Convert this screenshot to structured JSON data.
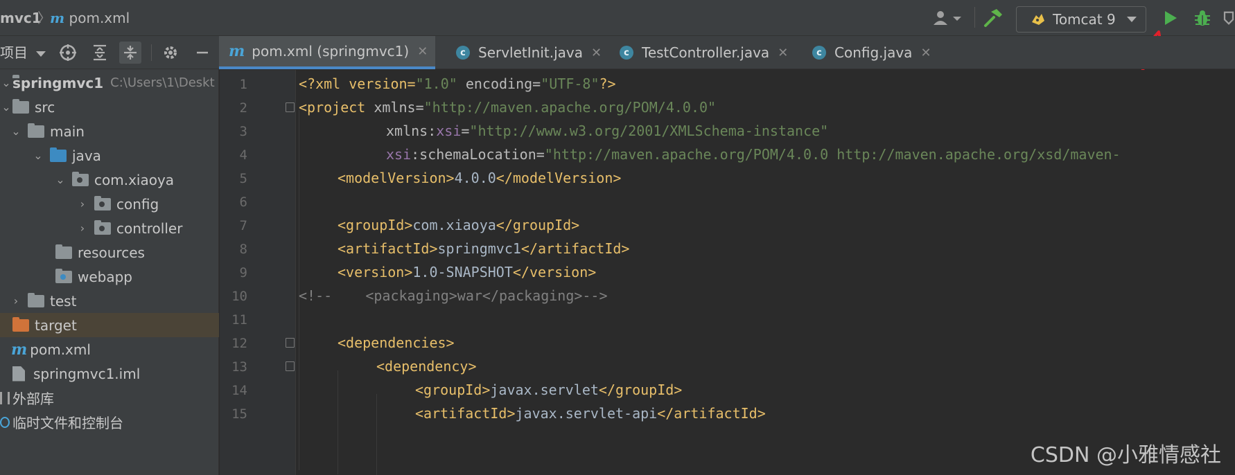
{
  "titlebar": {
    "project_crumb": "mvc1",
    "file_crumb": "pom.xml",
    "run_config": "Tomcat 9"
  },
  "project_toolbar": {
    "view_label": "项目"
  },
  "tabs": [
    {
      "label": "pom.xml (springmvc1)",
      "icon": "maven-icon",
      "active": true
    },
    {
      "label": "ServletInit.java",
      "icon": "class-icon",
      "active": false
    },
    {
      "label": "TestController.java",
      "icon": "class-icon",
      "active": false
    },
    {
      "label": "Config.java",
      "icon": "class-icon",
      "active": false
    }
  ],
  "tree": {
    "root_label": "springmvc1",
    "root_path": "C:\\Users\\1\\Deskt",
    "items": [
      {
        "label": "src"
      },
      {
        "label": "main"
      },
      {
        "label": "java"
      },
      {
        "label": "com.xiaoya"
      },
      {
        "label": "config"
      },
      {
        "label": "controller"
      },
      {
        "label": "resources"
      },
      {
        "label": "webapp"
      },
      {
        "label": "test"
      },
      {
        "label": "target"
      },
      {
        "label": "pom.xml"
      },
      {
        "label": "springmvc1.iml"
      },
      {
        "label": "外部库"
      },
      {
        "label": "临时文件和控制台"
      }
    ]
  },
  "editor": {
    "line_numbers": [
      "1",
      "2",
      "3",
      "4",
      "5",
      "6",
      "7",
      "8",
      "9",
      "10",
      "11",
      "12",
      "13",
      "14",
      "15"
    ],
    "lines": {
      "l1_a": "<?xml version=",
      "l1_b": "\"1.0\"",
      "l1_c": " encoding=",
      "l1_d": "\"UTF-8\"",
      "l1_e": "?>",
      "l2_a": "<project ",
      "l2_b": "xmlns=",
      "l2_c": "\"http://maven.apache.org/POM/4.0.0\"",
      "l3_a": "xmlns:",
      "l3_b": "xsi",
      "l3_c": "=",
      "l3_d": "\"http://www.w3.org/2001/XMLSchema-instance\"",
      "l4_a": "xsi",
      "l4_b": ":schemaLocation=",
      "l4_c": "\"http://maven.apache.org/POM/4.0.0 http://maven.apache.org/xsd/maven-",
      "l5_a": "<modelVersion>",
      "l5_b": "4.0.0",
      "l5_c": "</modelVersion>",
      "l7_a": "<groupId>",
      "l7_b": "com.xiaoya",
      "l7_c": "</groupId>",
      "l8_a": "<artifactId>",
      "l8_b": "springmvc1",
      "l8_c": "</artifactId>",
      "l9_a": "<version>",
      "l9_b": "1.0-SNAPSHOT",
      "l9_c": "</version>",
      "l10": "<!--    <packaging>war</packaging>-->",
      "l12": "<dependencies>",
      "l13": "<dependency>",
      "l14_a": "<groupId>",
      "l14_b": "javax.servlet",
      "l14_c": "</groupId>",
      "l15_a": "<artifactId>",
      "l15_b": "javax.servlet-api",
      "l15_c": "</artifactId>"
    }
  },
  "watermark": "CSDN @小雅情感社",
  "colors": {
    "annotation_arrow": "#e0202a",
    "run": "#4caf50",
    "debug": "#4caf50",
    "accent": "#4a88c7"
  }
}
